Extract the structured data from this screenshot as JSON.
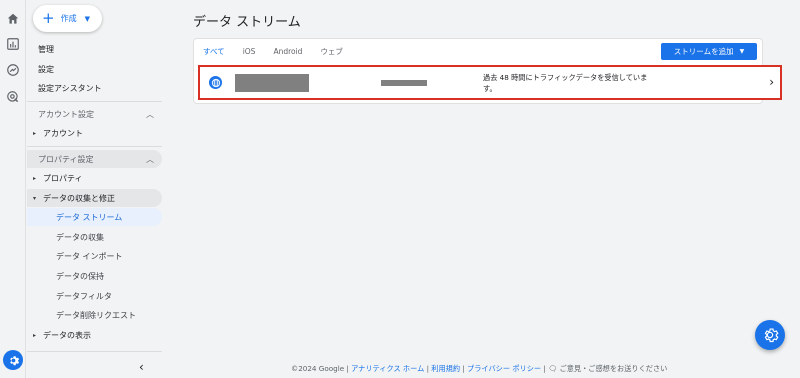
{
  "rail": {
    "icons": [
      "home-icon",
      "bar-chart-icon",
      "explore-icon",
      "advertising-icon"
    ],
    "settings_icon": "gear-icon"
  },
  "sidebar": {
    "create_label": "作成",
    "admin": "管理",
    "settings": "設定",
    "setup_assistant": "設定アシスタント",
    "account_settings": "アカウント設定",
    "account": "アカウント",
    "property_settings": "プロパティ設定",
    "property": "プロパティ",
    "data_collection_modification": "データの収集と修正",
    "sub_items": [
      "データ ストリーム",
      "データの収集",
      "データ インポート",
      "データの保持",
      "データフィルタ",
      "データ削除リクエスト"
    ],
    "data_display": "データの表示"
  },
  "main": {
    "title": "データ ストリーム",
    "tabs": [
      "すべて",
      "iOS",
      "Android",
      "ウェブ"
    ],
    "add_stream_label": "ストリームを追加",
    "stream_row": {
      "status": "過去 48 時間にトラフィックデータを受信しています。"
    }
  },
  "footer": {
    "copyright": "©2024 Google",
    "sep": " | ",
    "analytics_home": "アナリティクス ホーム",
    "terms": "利用規約",
    "privacy": "プライバシー ポリシー",
    "feedback": "ご意見・ご感想をお送りください"
  },
  "colors": {
    "accent": "#1a73e8",
    "highlight_border": "#d93025",
    "active_bg": "#e8f0fe"
  }
}
